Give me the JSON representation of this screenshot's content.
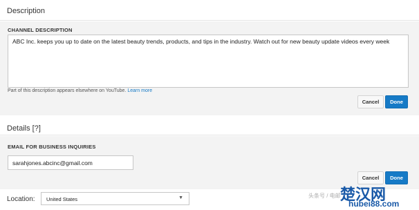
{
  "description_section": {
    "title": "Description",
    "field_label": "CHANNEL DESCRIPTION",
    "value": "ABC Inc. keeps you up to date on the latest beauty trends, products, and tips in the industry. Watch out for new beauty update videos every week",
    "help_text": "Part of this description appears elsewhere on YouTube.",
    "help_link": "Learn more",
    "cancel_label": "Cancel",
    "done_label": "Done"
  },
  "details_section": {
    "title": "Details [?]",
    "field_label": "EMAIL FOR BUSINESS INQUIRIES",
    "email_value": "sarahjones.abcinc@gmail.com",
    "cancel_label": "Cancel",
    "done_label": "Done"
  },
  "location": {
    "label": "Location:",
    "selected": "United States"
  },
  "watermark": {
    "small_text": "头条号 / 电邮",
    "brand": "楚汉网",
    "url": "hubei88.com"
  },
  "colors": {
    "accent": "#167ac6",
    "panel_bg": "#f3f3f3"
  },
  "icons": {
    "select_caret": "caret-down-icon"
  }
}
